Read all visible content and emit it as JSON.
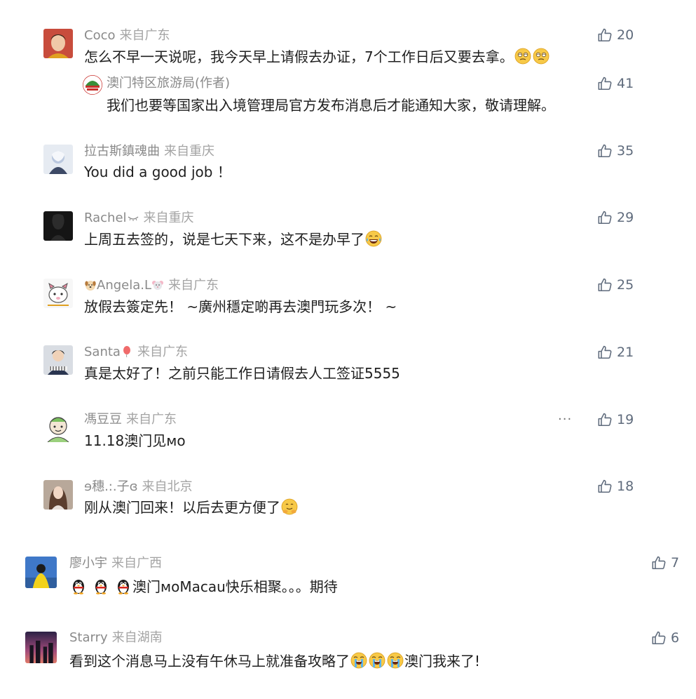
{
  "comments": [
    {
      "user": "Coco",
      "location": "来自广东",
      "text": "怎么不早一天说呢，我今天早上请假去办证，7个工作日后又要去拿。",
      "likes": "20"
    },
    {
      "user": "拉古斯鎮魂曲",
      "location": "来自重庆",
      "text": "You did a good job ！",
      "likes": "35"
    },
    {
      "user": "Rachel",
      "location": "来自重庆",
      "text": "上周五去签的，说是七天下来，这不是办早了",
      "likes": "29"
    },
    {
      "user": "Angela.L",
      "location": "来自广东",
      "text": "放假去簽定先！ ~廣州穩定啲再去澳門玩多次！ ~",
      "likes": "25"
    },
    {
      "user": "Santa",
      "location": "来自广东",
      "text": "真是太好了！之前只能工作日请假去人工签证5555",
      "likes": "21"
    },
    {
      "user": "馮豆豆",
      "location": "来自广东",
      "text": "11.18澳门见ᴍᴏ",
      "likes": "19",
      "more": "···"
    },
    {
      "user": "ɘ穗.:.子ɞ",
      "location": "来自北京",
      "text": "刚从澳门回来！以后去更方便了",
      "likes": "18"
    },
    {
      "user": "廖小宇",
      "location": "来自广西",
      "text": "澳门ᴍᴏMacau快乐相聚。。。期待",
      "likes": "7"
    },
    {
      "user": "Starry",
      "location": "来自湖南",
      "text": "看到这个消息马上没有午休马上就准备攻略了",
      "text_suffix": "澳门我来了!",
      "likes": "6"
    }
  ],
  "reply": {
    "user": "澳门特区旅游局(作者)",
    "text": "我们也要等国家出入境管理局官方发布消息后才能通知大家，敬请理解。",
    "likes": "41"
  },
  "icons": {
    "like": "thumbs-up-icon",
    "more": "more-dots-icon",
    "tourism_logo": "macao-tourism-logo"
  },
  "colors": {
    "username": "#8a8a8a",
    "location": "#a4a4a4",
    "text": "#1f1f1f",
    "like": "#5f6b7c"
  }
}
